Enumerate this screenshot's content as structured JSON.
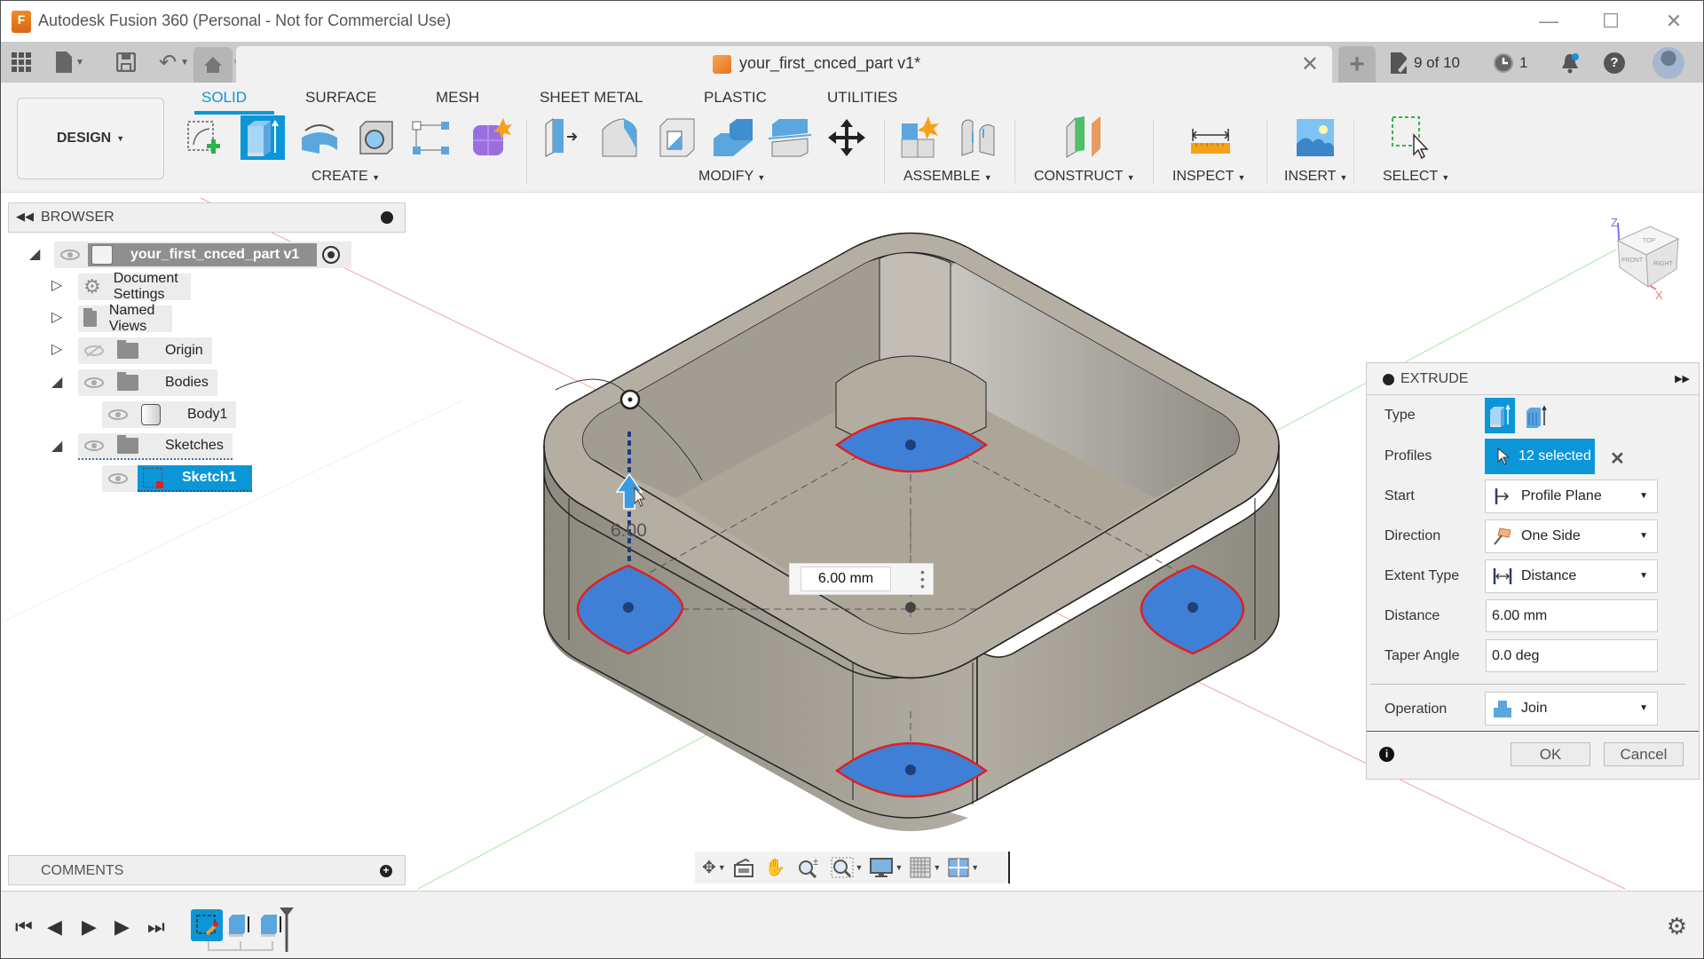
{
  "window": {
    "title": "Autodesk Fusion 360 (Personal - Not for Commercial Use)",
    "logo_letter": "F",
    "minimize": "—",
    "maximize": "☐",
    "close": "✕"
  },
  "quick_access": {
    "document_tab_title": "your_first_cnced_part v1*",
    "tab_close": "✕",
    "new_tab": "+",
    "job_status": "9 of 10",
    "clock_count": "1",
    "help": "?"
  },
  "ribbon": {
    "workspace": "DESIGN",
    "tabs": [
      {
        "label": "SOLID",
        "active": true
      },
      {
        "label": "SURFACE",
        "active": false
      },
      {
        "label": "MESH",
        "active": false
      },
      {
        "label": "SHEET METAL",
        "active": false
      },
      {
        "label": "PLASTIC",
        "active": false
      },
      {
        "label": "UTILITIES",
        "active": false
      }
    ],
    "groups": [
      {
        "label": "CREATE"
      },
      {
        "label": "MODIFY"
      },
      {
        "label": "ASSEMBLE"
      },
      {
        "label": "CONSTRUCT"
      },
      {
        "label": "INSPECT"
      },
      {
        "label": "INSERT"
      },
      {
        "label": "SELECT"
      }
    ],
    "accent": "#0b96d8"
  },
  "browser": {
    "title": "BROWSER",
    "root": "your_first_cnced_part v1",
    "items": [
      {
        "label": "Document Settings"
      },
      {
        "label": "Named Views"
      },
      {
        "label": "Origin"
      },
      {
        "label": "Bodies"
      },
      {
        "label": "Body1"
      },
      {
        "label": "Sketches"
      },
      {
        "label": "Sketch1"
      }
    ]
  },
  "comments": {
    "title": "COMMENTS"
  },
  "viewport": {
    "dimension_value": "6.00 mm",
    "dimension_label": "6.00",
    "viewcube": {
      "top": "TOP",
      "front": "FRONT",
      "right": "RIGHT",
      "z": "Z",
      "x": "X"
    }
  },
  "extrude": {
    "title": "EXTRUDE",
    "fields": {
      "type_label": "Type",
      "profiles_label": "Profiles",
      "profiles_value": "12 selected",
      "start_label": "Start",
      "start_value": "Profile Plane",
      "direction_label": "Direction",
      "direction_value": "One Side",
      "extent_label": "Extent Type",
      "extent_value": "Distance",
      "distance_label": "Distance",
      "distance_value": "6.00 mm",
      "taper_label": "Taper Angle",
      "taper_value": "0.0 deg",
      "operation_label": "Operation",
      "operation_value": "Join"
    },
    "ok": "OK",
    "cancel": "Cancel"
  }
}
